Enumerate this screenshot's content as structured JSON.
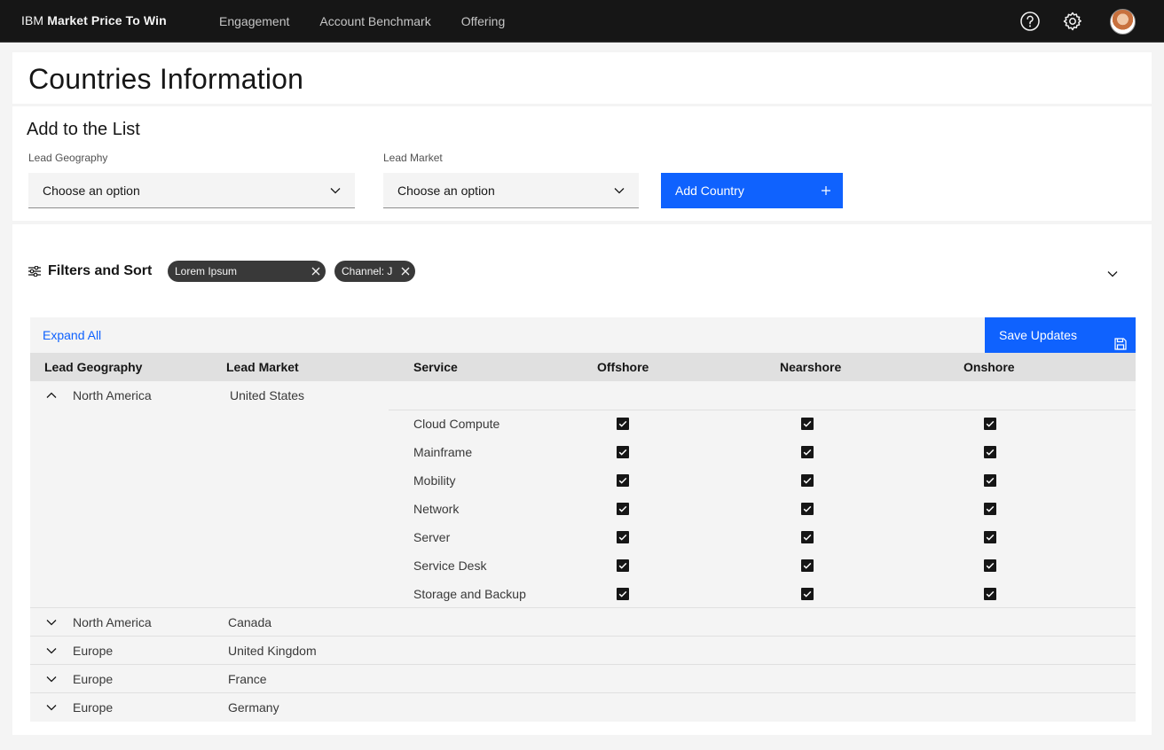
{
  "header": {
    "brand_prefix": "IBM",
    "brand_name": "Market Price To Win",
    "nav": [
      "Engagement",
      "Account Benchmark",
      "Offering"
    ],
    "icons": [
      "help-icon",
      "settings-icon",
      "user-avatar"
    ]
  },
  "page": {
    "title": "Countries Information"
  },
  "add_form": {
    "title": "Add to the List",
    "geography_label": "Lead Geography",
    "geography_value": "Choose an option",
    "market_label": "Lead Market",
    "market_value": "Choose an option",
    "add_button": "Add Country"
  },
  "filters": {
    "label": "Filters and Sort",
    "tags": [
      "Lorem Ipsum",
      "Channel: J"
    ]
  },
  "table": {
    "expand_all": "Expand All",
    "save_button": "Save Updates",
    "columns": [
      "Lead Geography",
      "Lead Market",
      "Service",
      "Offshore",
      "Nearshore",
      "Onshore"
    ],
    "expanded_row": {
      "geography": "North America",
      "market": "United States",
      "services": [
        {
          "name": "Cloud Compute",
          "offshore": true,
          "nearshore": true,
          "onshore": true
        },
        {
          "name": "Mainframe",
          "offshore": true,
          "nearshore": true,
          "onshore": true
        },
        {
          "name": "Mobility",
          "offshore": true,
          "nearshore": true,
          "onshore": true
        },
        {
          "name": "Network",
          "offshore": true,
          "nearshore": true,
          "onshore": true
        },
        {
          "name": "Server",
          "offshore": true,
          "nearshore": true,
          "onshore": true
        },
        {
          "name": "Service Desk",
          "offshore": true,
          "nearshore": true,
          "onshore": true
        },
        {
          "name": "Storage and Backup",
          "offshore": true,
          "nearshore": true,
          "onshore": true
        }
      ]
    },
    "rows": [
      {
        "geography": "North America",
        "market": "Canada"
      },
      {
        "geography": "Europe",
        "market": "United Kingdom"
      },
      {
        "geography": "Europe",
        "market": "France"
      },
      {
        "geography": "Europe",
        "market": "Germany"
      }
    ]
  }
}
